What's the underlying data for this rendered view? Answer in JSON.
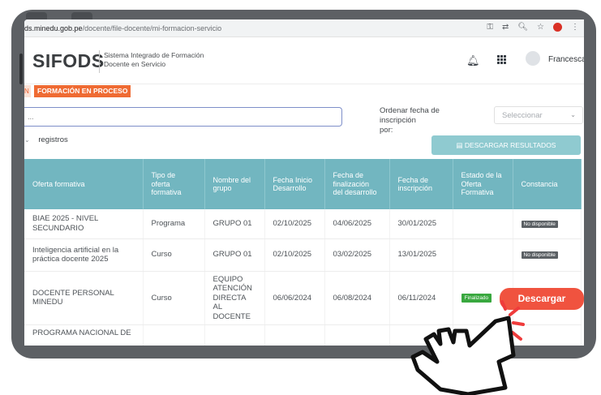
{
  "browser": {
    "url_host": "ds.minedu.gob.pe",
    "url_path": "/docente/file-docente/mi-formacion-servicio",
    "icons": [
      "key-icon",
      "translate-icon",
      "zoom-icon",
      "star-icon",
      "extension-icon",
      "menu-icon"
    ]
  },
  "header": {
    "logo": "SIFODS",
    "subtitle_line1": "Sistema Integrado de Formación",
    "subtitle_line2": "Docente en Servicio",
    "user_name": "Francesca"
  },
  "tabs": {
    "previous_fragment": "N",
    "active": "FORMACIÓN EN PROCESO"
  },
  "filters": {
    "search_value": "...",
    "sort_label_line1": "Ordenar fecha de inscripción",
    "sort_label_line2": "por:",
    "select_value": "Seleccionar",
    "records_label": "registros",
    "download_all": "DESCARGAR RESULTADOS"
  },
  "table": {
    "headers": [
      "Oferta formativa",
      "Tipo de oferta formativa",
      "Nombre del grupo",
      "Fecha Inicio Desarrollo",
      "Fecha de finalización del desarrollo",
      "Fecha de inscripción",
      "Estado de la Oferta Formativa",
      "Constancia"
    ],
    "rows": [
      {
        "oferta": "BIAE 2025 - NIVEL SECUNDARIO",
        "tipo": "Programa",
        "grupo": "GRUPO 01",
        "inicio": "02/10/2025",
        "fin": "04/06/2025",
        "inscripcion": "30/01/2025",
        "estado": "",
        "constancia": "No disponible"
      },
      {
        "oferta": "Inteligencia artificial en la práctica docente 2025",
        "tipo": "Curso",
        "grupo": "GRUPO 01",
        "inicio": "02/10/2025",
        "fin": "03/02/2025",
        "inscripcion": "13/01/2025",
        "estado": "",
        "constancia": "No disponible"
      },
      {
        "oferta": "DOCENTE PERSONAL MINEDU",
        "tipo": "Curso",
        "grupo": "EQUIPO ATENCIÓN DIRECTA AL DOCENTE",
        "inicio": "06/06/2024",
        "fin": "06/08/2024",
        "inscripcion": "06/11/2024",
        "estado": "Finalizado",
        "constancia": ""
      },
      {
        "oferta": "PROGRAMA NACIONAL DE",
        "tipo": "",
        "grupo": "",
        "inicio": "",
        "fin": "",
        "inscripcion": "",
        "estado": "",
        "constancia": ""
      }
    ]
  },
  "overlay": {
    "download_label": "Descargar"
  },
  "colors": {
    "accent_orange": "#ef6b33",
    "table_header": "#72b6c0",
    "download_red": "#f0533f",
    "status_green": "#39a83f"
  }
}
